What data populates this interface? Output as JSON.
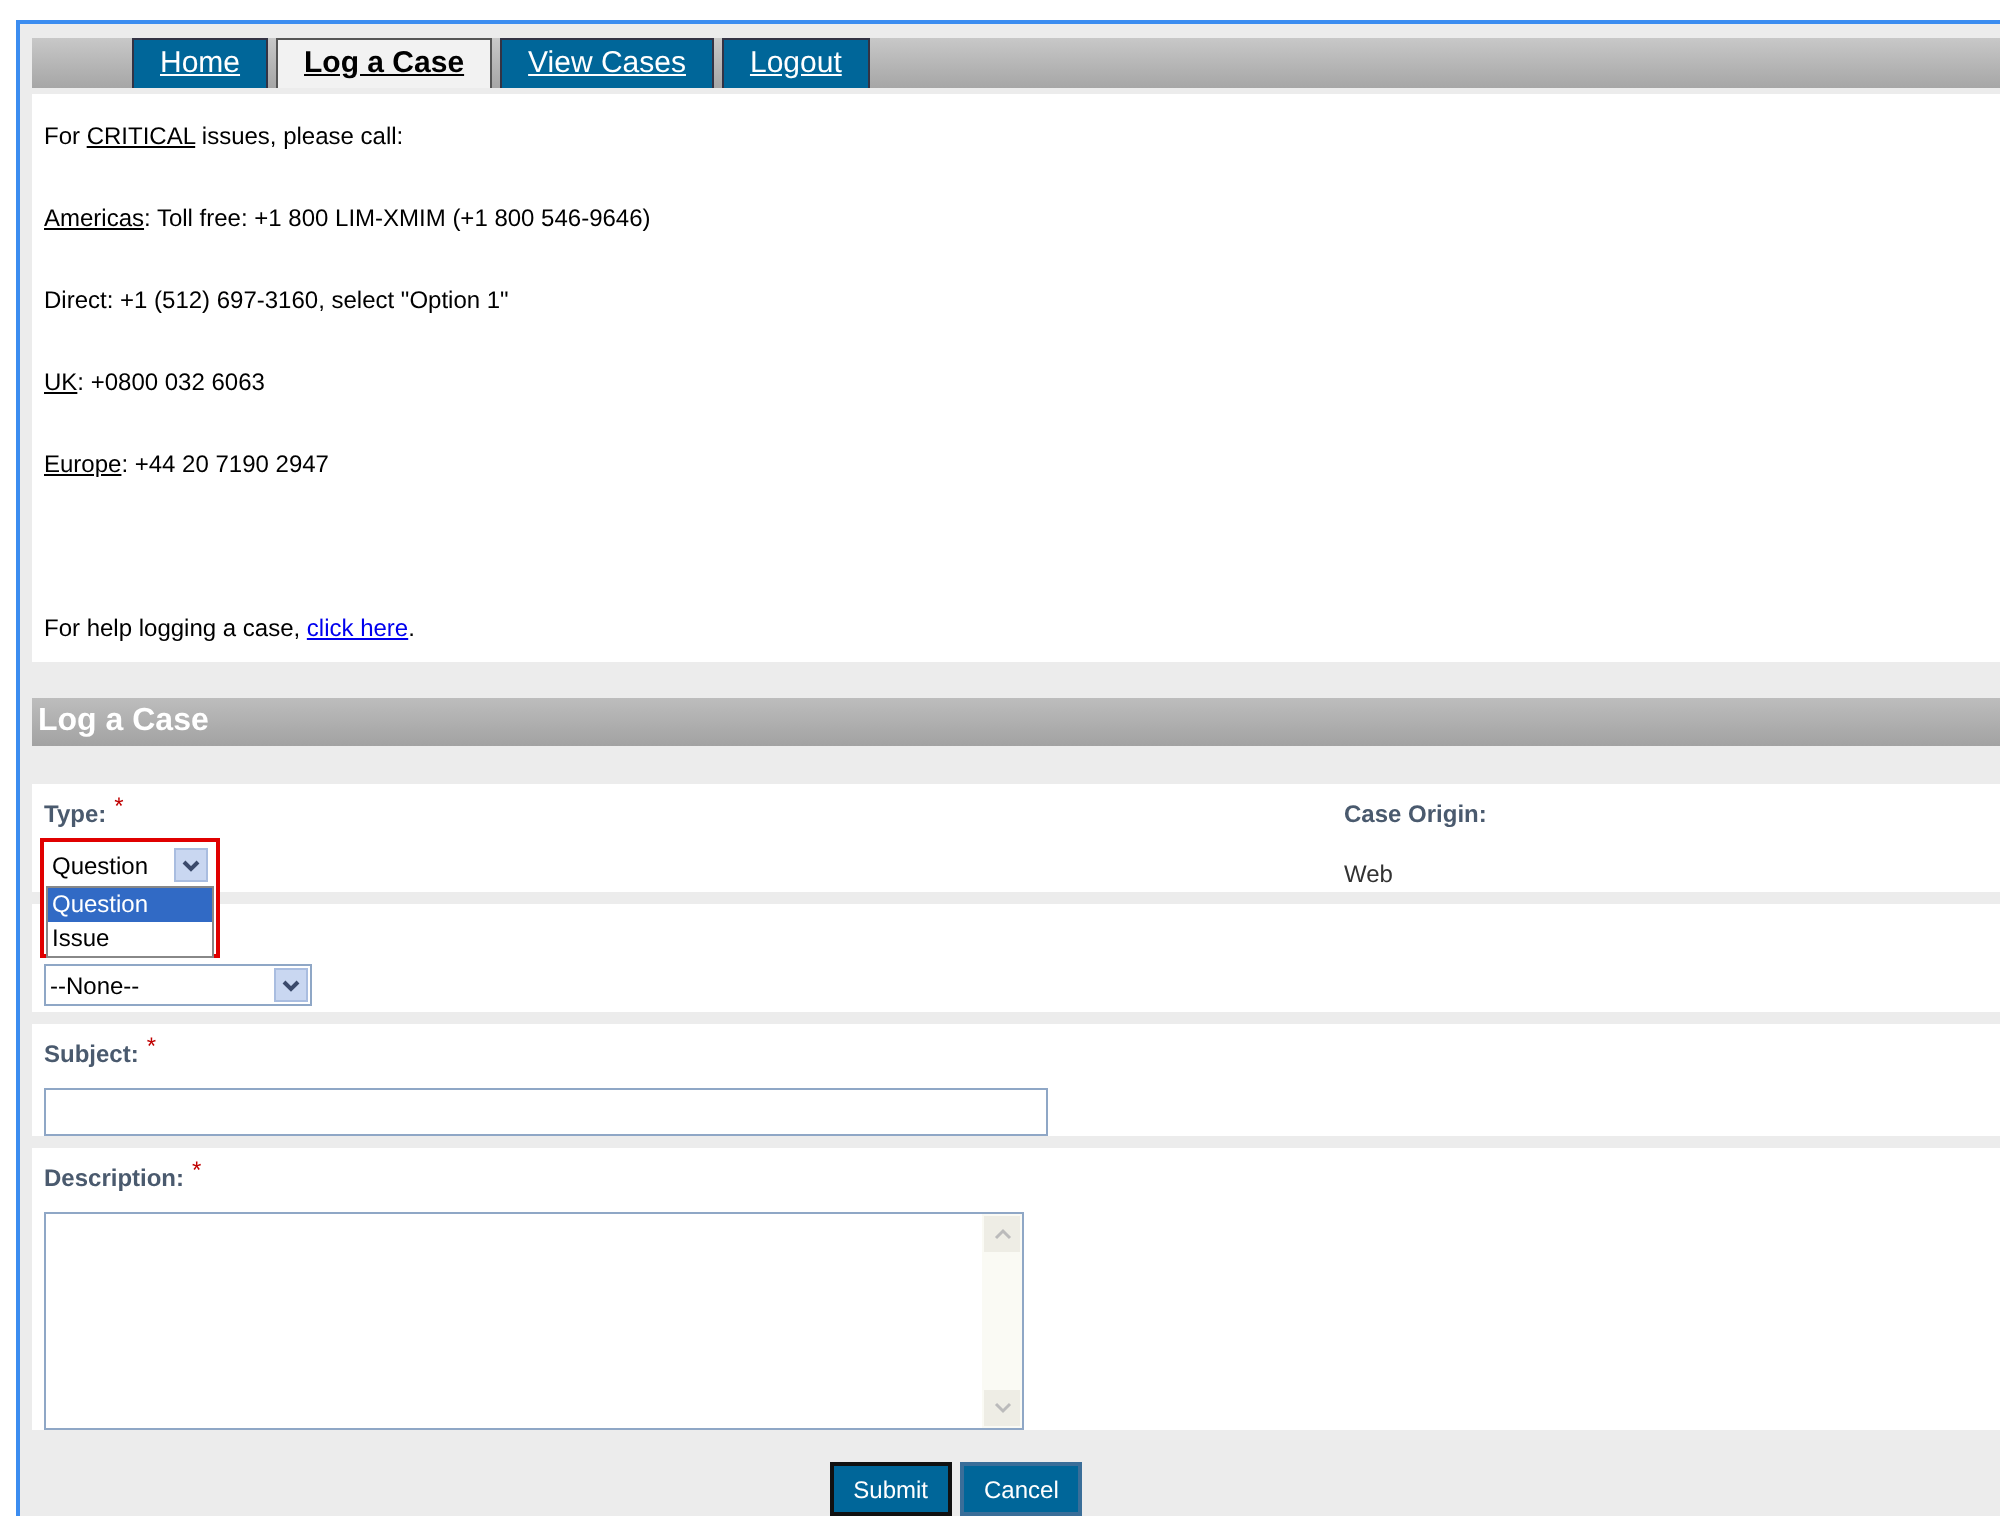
{
  "tabs": [
    {
      "label": "Home",
      "selected": false
    },
    {
      "label": "Log a Case",
      "selected": true
    },
    {
      "label": "View Cases",
      "selected": false
    },
    {
      "label": "Logout",
      "selected": false
    }
  ],
  "contact_lines": [
    {
      "before": "For ",
      "key": "CRITICAL",
      "after": " issues, please call:"
    },
    {
      "key": "Americas",
      "after": ": Toll free: +1 800 LIM-XMIM (+1 800 546-9646)"
    },
    {
      "before": "Direct: +1 (512) 697-3160, select \"Option 1\""
    },
    {
      "key": "UK",
      "after": ": +0800 032 6063"
    },
    {
      "key": "Europe",
      "after": ": +44 20 7190 2947"
    }
  ],
  "required_mark": "*",
  "help": {
    "text": "For help logging a case, ",
    "link": "click here",
    "end": "."
  },
  "section_title": "Log a Case",
  "type_field": {
    "label": "Type:",
    "required": true,
    "value": "Question",
    "options": [
      {
        "label": "Question",
        "selected": true
      },
      {
        "label": "Issue",
        "selected": false
      }
    ]
  },
  "case_origin": {
    "label": "Case Origin:",
    "value": "Web"
  },
  "second_select": {
    "value": "--None--"
  },
  "subject": {
    "label": "Subject:",
    "required": true
  },
  "description": {
    "label": "Description:",
    "required": true
  },
  "buttons": [
    {
      "label": "Submit",
      "focused": true
    },
    {
      "label": "Cancel",
      "focused": false
    }
  ]
}
